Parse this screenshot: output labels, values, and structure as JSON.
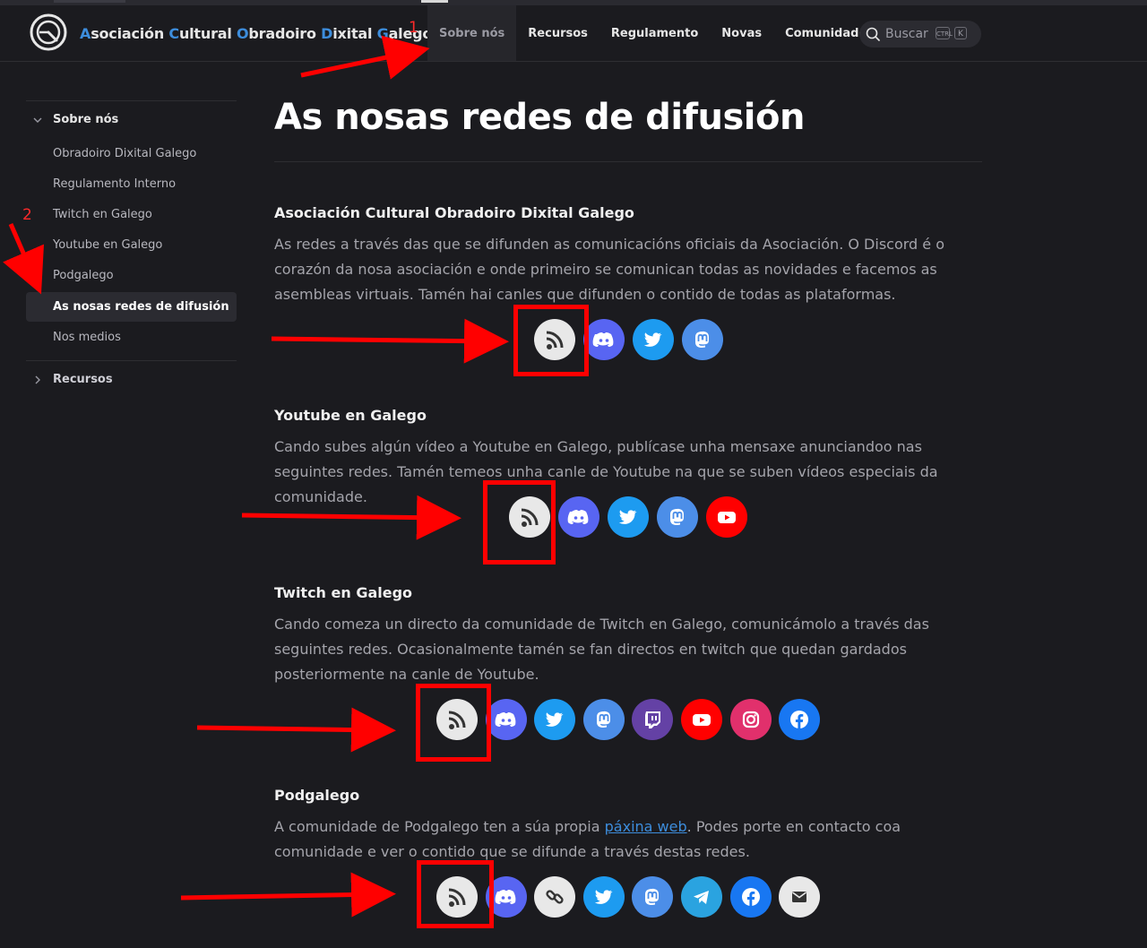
{
  "header": {
    "brand_first": [
      "A",
      "C",
      "O",
      "D",
      "G"
    ],
    "brand_parts": [
      "sociación ",
      "ultural ",
      "bradoiro ",
      "ixital ",
      "alego"
    ],
    "nav": [
      {
        "label": "Sobre nós",
        "active": true
      },
      {
        "label": "Recursos"
      },
      {
        "label": "Regulamento"
      },
      {
        "label": "Novas"
      },
      {
        "label": "Comunidade"
      }
    ],
    "search": {
      "label": "Buscar",
      "kbd1": "CTRL",
      "kbd2": "K"
    }
  },
  "sidebar": {
    "group_open": "Sobre nós",
    "items": [
      {
        "label": "Obradoiro Dixital Galego"
      },
      {
        "label": "Regulamento Interno"
      },
      {
        "label": "Twitch en Galego"
      },
      {
        "label": "Youtube en Galego"
      },
      {
        "label": "Podgalego"
      },
      {
        "label": "As nosas redes de difusión",
        "active": true
      },
      {
        "label": "Nos medios"
      }
    ],
    "group_closed": "Recursos"
  },
  "page": {
    "title": "As nosas redes de difusión",
    "sections": [
      {
        "title": "Asociación Cultural Obradoiro Dixital Galego",
        "text": "As redes a través das que se difunden as comunicacións oficiais da Asociación. O Discord é o corazón da nosa asociación e onde primeiro se comunican todas as novidades e facemos as asembleas virtuais. Tamén hai canles que difunden o contido de todas as plataformas.",
        "icons": [
          "rss-icon",
          "discord-icon",
          "twitter-icon",
          "mastodon-icon"
        ]
      },
      {
        "title": "Youtube en Galego",
        "text": "Cando subes algún vídeo a Youtube en Galego, publícase unha mensaxe anunciandoo nas seguintes redes. Tamén temeos unha canle de Youtube na que se suben vídeos especiais da comunidade.",
        "icons": [
          "rss-icon",
          "discord-icon",
          "twitter-icon",
          "mastodon-icon",
          "youtube-icon"
        ]
      },
      {
        "title": "Twitch en Galego",
        "text": "Cando comeza un directo da comunidade de Twitch en Galego, comunicámolo a través das seguintes redes. Ocasionalmente tamén se fan directos en twitch que quedan gardados posteriormente na canle de Youtube.",
        "icons": [
          "rss-icon",
          "discord-icon",
          "twitter-icon",
          "mastodon-icon",
          "twitch-icon",
          "youtube-icon",
          "instagram-icon",
          "facebook-icon"
        ]
      },
      {
        "title": "Podgalego",
        "text_before": "A comunidade de Podgalego ten a súa propia ",
        "link": "páxina web",
        "text_after": ". Podes porte en contacto coa comunidade e ver o contido que se difunde a través destas redes.",
        "icons": [
          "rss-icon",
          "discord-icon",
          "link-icon",
          "twitter-icon",
          "mastodon-icon",
          "telegram-icon",
          "facebook-icon",
          "email-icon"
        ]
      }
    ]
  },
  "annotations": {
    "marker1": "1",
    "marker2": "2"
  },
  "colors": {
    "bg": "#1b1b1f",
    "accent": "#3d8ddc",
    "annotation": "#ff0000",
    "discord": "#5865f2",
    "twitter": "#1d9bf0",
    "mastodon": "#4c8ee8",
    "youtube": "#ff0000",
    "twitch": "#6441a5",
    "instagram": "#e1306c",
    "facebook": "#1877f2",
    "telegram": "#2aa3e0"
  }
}
